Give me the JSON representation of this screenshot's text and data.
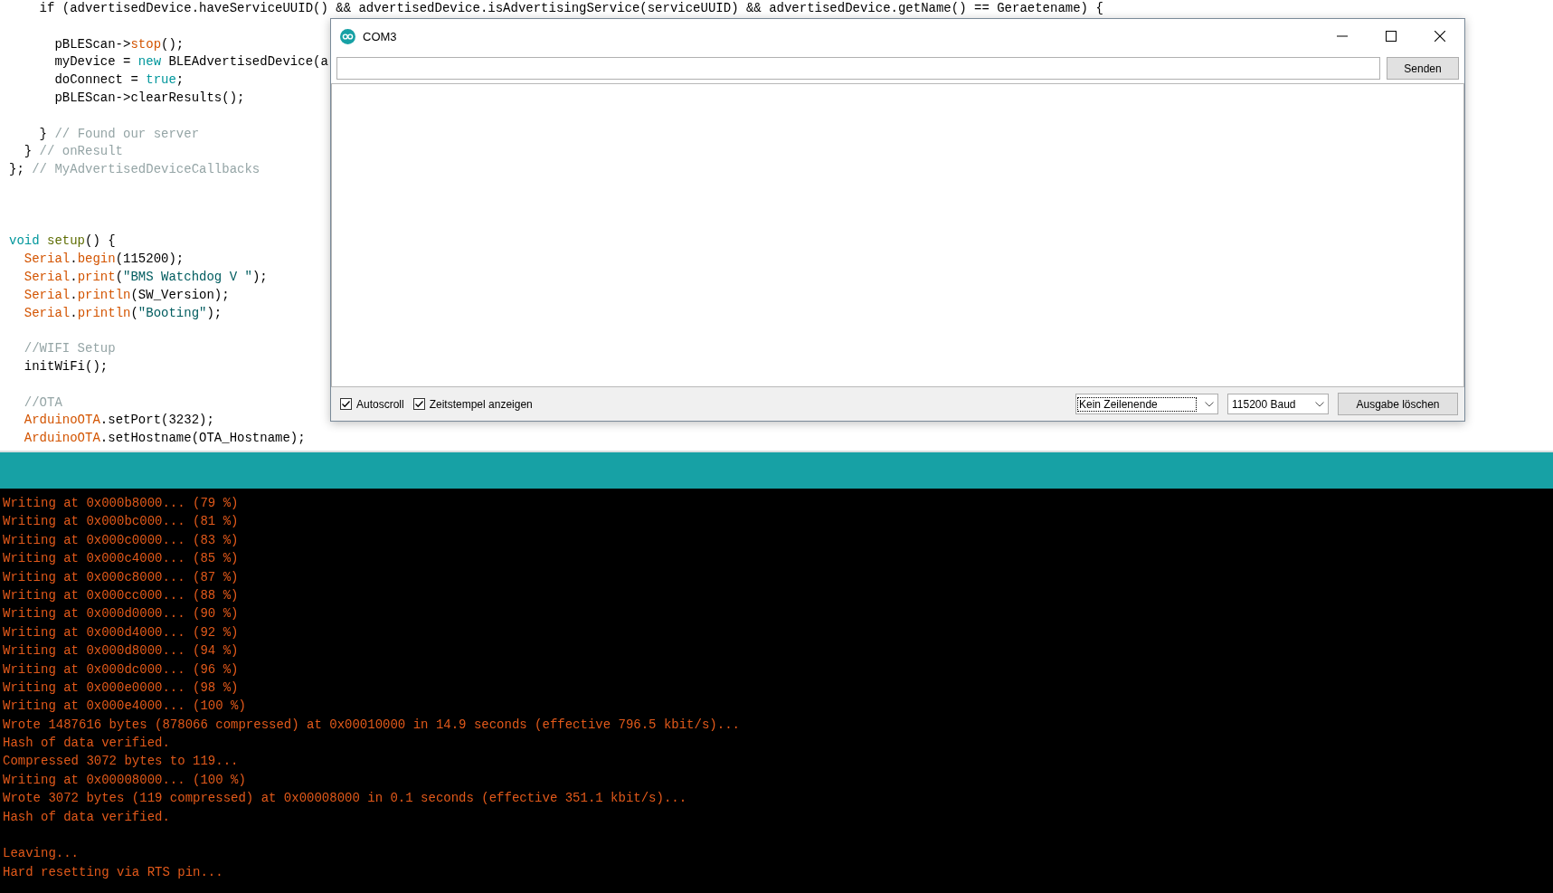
{
  "editor": {
    "lines": [
      {
        "kind": "code",
        "tokens": [
          {
            "kind": "plain",
            "text": "    if (advertisedDevice.haveServiceUUID() && advertisedDevice.isAdvertisingService(serviceUUID) && advertisedDevice.getName() == Geraetename) {"
          }
        ]
      },
      {
        "kind": "blank"
      },
      {
        "kind": "code",
        "tokens": [
          {
            "kind": "plain",
            "text": "      pBLEScan->"
          },
          {
            "kind": "function",
            "text": "stop"
          },
          {
            "kind": "plain",
            "text": "();"
          }
        ]
      },
      {
        "kind": "code",
        "tokens": [
          {
            "kind": "plain",
            "text": "      myDevice = "
          },
          {
            "kind": "keyword",
            "text": "new"
          },
          {
            "kind": "plain",
            "text": " BLEAdvertisedDevice(a"
          }
        ]
      },
      {
        "kind": "code",
        "tokens": [
          {
            "kind": "plain",
            "text": "      doConnect = "
          },
          {
            "kind": "keyword",
            "text": "true"
          },
          {
            "kind": "plain",
            "text": ";"
          }
        ]
      },
      {
        "kind": "code",
        "tokens": [
          {
            "kind": "plain",
            "text": "      pBLEScan->clearResults();"
          }
        ]
      },
      {
        "kind": "blank"
      },
      {
        "kind": "code",
        "tokens": [
          {
            "kind": "plain",
            "text": "    } "
          },
          {
            "kind": "comment",
            "text": "// Found our server"
          }
        ]
      },
      {
        "kind": "code",
        "tokens": [
          {
            "kind": "plain",
            "text": "  } "
          },
          {
            "kind": "comment",
            "text": "// onResult"
          }
        ]
      },
      {
        "kind": "code",
        "tokens": [
          {
            "kind": "plain",
            "text": "}; "
          },
          {
            "kind": "comment",
            "text": "// MyAdvertisedDeviceCallbacks"
          }
        ]
      },
      {
        "kind": "blank"
      },
      {
        "kind": "blank"
      },
      {
        "kind": "blank"
      },
      {
        "kind": "code",
        "tokens": [
          {
            "kind": "keyword",
            "text": "void"
          },
          {
            "kind": "builtin",
            "text": " setup"
          },
          {
            "kind": "plain",
            "text": "() {"
          }
        ]
      },
      {
        "kind": "code",
        "tokens": [
          {
            "kind": "function",
            "text": "  Serial"
          },
          {
            "kind": "plain",
            "text": "."
          },
          {
            "kind": "function",
            "text": "begin"
          },
          {
            "kind": "plain",
            "text": "(115200);"
          }
        ]
      },
      {
        "kind": "code",
        "tokens": [
          {
            "kind": "function",
            "text": "  Serial"
          },
          {
            "kind": "plain",
            "text": "."
          },
          {
            "kind": "function",
            "text": "print"
          },
          {
            "kind": "plain",
            "text": "("
          },
          {
            "kind": "string",
            "text": "\"BMS Watchdog V \""
          },
          {
            "kind": "plain",
            "text": ");"
          }
        ]
      },
      {
        "kind": "code",
        "tokens": [
          {
            "kind": "function",
            "text": "  Serial"
          },
          {
            "kind": "plain",
            "text": "."
          },
          {
            "kind": "function",
            "text": "println"
          },
          {
            "kind": "plain",
            "text": "(SW_Version);"
          }
        ]
      },
      {
        "kind": "code",
        "tokens": [
          {
            "kind": "function",
            "text": "  Serial"
          },
          {
            "kind": "plain",
            "text": "."
          },
          {
            "kind": "function",
            "text": "println"
          },
          {
            "kind": "plain",
            "text": "("
          },
          {
            "kind": "string",
            "text": "\"Booting\""
          },
          {
            "kind": "plain",
            "text": ");"
          }
        ]
      },
      {
        "kind": "blank"
      },
      {
        "kind": "code",
        "tokens": [
          {
            "kind": "comment",
            "text": "  //WIFI Setup"
          }
        ]
      },
      {
        "kind": "code",
        "tokens": [
          {
            "kind": "plain",
            "text": "  initWiFi();"
          }
        ]
      },
      {
        "kind": "blank"
      },
      {
        "kind": "code",
        "tokens": [
          {
            "kind": "comment",
            "text": "  //OTA"
          }
        ]
      },
      {
        "kind": "code",
        "tokens": [
          {
            "kind": "function",
            "text": "  ArduinoOTA"
          },
          {
            "kind": "plain",
            "text": ".setPort(3232);"
          }
        ]
      },
      {
        "kind": "code",
        "tokens": [
          {
            "kind": "function",
            "text": "  ArduinoOTA"
          },
          {
            "kind": "plain",
            "text": ".setHostname(OTA_Hostname);"
          }
        ]
      }
    ]
  },
  "serial_monitor": {
    "title": "COM3",
    "send_button": "Senden",
    "autoscroll": {
      "label": "Autoscroll",
      "checked": true
    },
    "timestamps": {
      "label": "Zeitstempel anzeigen",
      "checked": true
    },
    "line_ending": {
      "value": "Kein Zeilenende"
    },
    "baud_rate": {
      "value": "115200 Baud"
    },
    "clear_button": "Ausgabe löschen"
  },
  "console": {
    "blocks": [
      [
        "Writing at 0x000b8000... (79 %)",
        "Writing at 0x000bc000... (81 %)",
        "Writing at 0x000c0000... (83 %)",
        "Writing at 0x000c4000... (85 %)",
        "Writing at 0x000c8000... (87 %)",
        "Writing at 0x000cc000... (88 %)",
        "Writing at 0x000d0000... (90 %)",
        "Writing at 0x000d4000... (92 %)",
        "Writing at 0x000d8000... (94 %)",
        "Writing at 0x000dc000... (96 %)",
        "Writing at 0x000e0000... (98 %)",
        "Writing at 0x000e4000... (100 %)",
        "Wrote 1487616 bytes (878066 compressed) at 0x00010000 in 14.9 seconds (effective 796.5 kbit/s)...",
        "Hash of data verified.",
        "Compressed 3072 bytes to 119...",
        "Writing at 0x00008000... (100 %)",
        "Wrote 3072 bytes (119 compressed) at 0x00008000 in 0.1 seconds (effective 351.1 kbit/s)...",
        "Hash of data verified."
      ],
      [
        "Leaving...",
        "Hard resetting via RTS pin..."
      ]
    ]
  }
}
